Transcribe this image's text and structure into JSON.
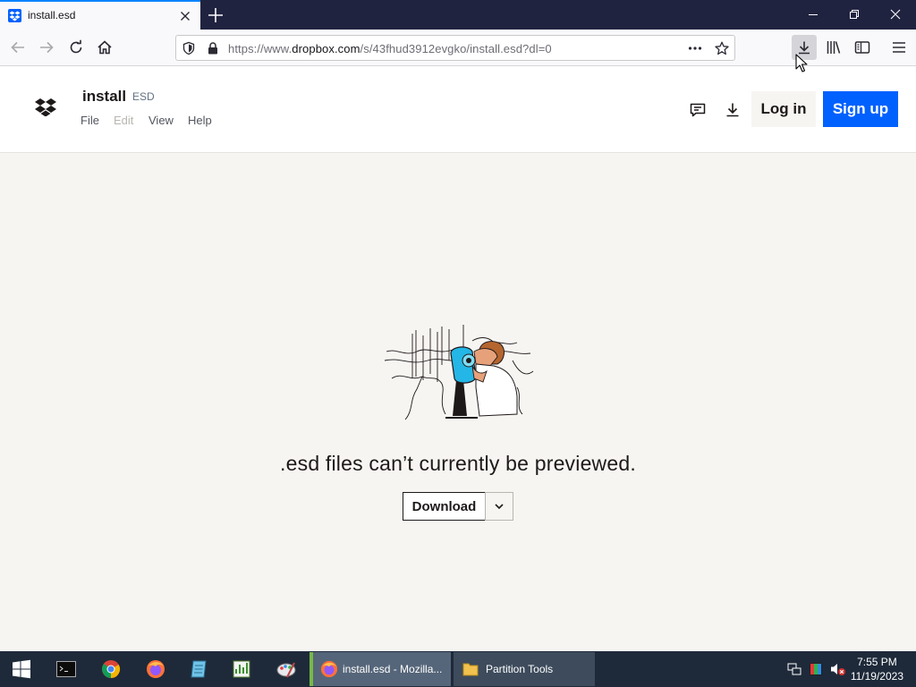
{
  "browser": {
    "tab": {
      "title": "install.esd"
    },
    "url": {
      "prefix": "https://www.",
      "host": "dropbox.com",
      "path": "/s/43fhud3912evgko/install.esd?dl=0"
    }
  },
  "header": {
    "file_name": "install",
    "file_ext": "ESD",
    "menu": [
      "File",
      "Edit",
      "View",
      "Help"
    ],
    "login_label": "Log in",
    "signup_label": "Sign up"
  },
  "main": {
    "message": ".esd files can’t currently be previewed.",
    "download_label": "Download"
  },
  "taskbar": {
    "apps": [
      {
        "label": "install.esd - Mozilla..."
      },
      {
        "label": "Partition Tools"
      }
    ],
    "time": "7:55 PM",
    "date": "11/19/2023"
  },
  "colors": {
    "dropbox_blue": "#0061fe",
    "page_bg": "#f7f5f2",
    "tab_strip": "#202340",
    "taskbar": "#1e2a3a"
  }
}
